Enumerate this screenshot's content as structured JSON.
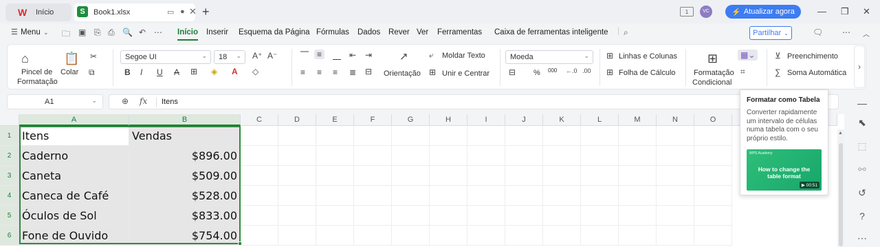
{
  "titlebar": {
    "home_tab": "Início",
    "doc_tab": "Book1.xlsx",
    "upgrade": "Atualizar agora",
    "avatar": "VC"
  },
  "menubar": {
    "menu": "Menu",
    "items": [
      "Início",
      "Inserir",
      "Esquema da Página",
      "Fórmulas",
      "Dados",
      "Rever",
      "Ver",
      "Ferramentas",
      "Caixa de ferramentas inteligente"
    ],
    "share": "Partilhar"
  },
  "ribbon": {
    "paint_format": "Pincel de",
    "paint_format2": "Formatação",
    "paste": "Colar",
    "font_name": "Segoe UI",
    "font_size": "18",
    "wrap_text": "Moldar Texto",
    "merge_center": "Unir e Centrar",
    "orientation": "Orientação",
    "number_format": "Moeda",
    "rows_cols": "Linhas e Colunas",
    "worksheet": "Folha de Cálculo",
    "cond_format": "Formatação",
    "cond_format2": "Condicional",
    "fill": "Preenchimento",
    "autosum": "Soma Automática",
    "percent": "%",
    "thousands": "000"
  },
  "formula_bar": {
    "name_box": "A1",
    "fx": "fx",
    "content": "Itens"
  },
  "sheet": {
    "columns": [
      "A",
      "B",
      "C",
      "D",
      "E",
      "F",
      "G",
      "H",
      "I",
      "J",
      "K",
      "L",
      "M",
      "N",
      "O"
    ],
    "row_numbers": [
      "1",
      "2",
      "3",
      "4",
      "5",
      "6"
    ],
    "rows": [
      {
        "a": "Itens",
        "b": "Vendas"
      },
      {
        "a": "Caderno",
        "b": "$896.00"
      },
      {
        "a": "Caneta",
        "b": "$509.00"
      },
      {
        "a": "Caneca de Café",
        "b": "$528.00"
      },
      {
        "a": "Óculos de Sol",
        "b": "$833.00"
      },
      {
        "a": "Fone de Ouvido",
        "b": "$754.00"
      }
    ]
  },
  "tooltip": {
    "title": "Formatar como Tabela",
    "description": "Converter rapidamente um intervalo de células numa tabela com o seu próprio estilo.",
    "video_title": "How to change the table format",
    "video_time": "00:51",
    "video_logo": "WPS Academy"
  },
  "colors": {
    "accent_green": "#1a7f37",
    "upgrade_blue": "#3d7cf2",
    "selection_green": "#2e8b3e"
  }
}
